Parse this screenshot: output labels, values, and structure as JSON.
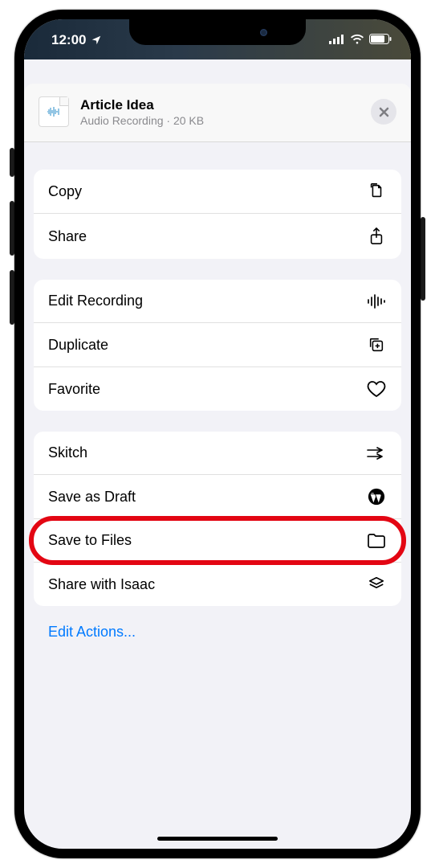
{
  "status": {
    "time": "12:00"
  },
  "header": {
    "title": "Article Idea",
    "subtitle": "Audio Recording · 20 KB"
  },
  "groups": [
    {
      "rows": [
        {
          "label": "Copy",
          "icon": "copy-icon"
        },
        {
          "label": "Share",
          "icon": "share-icon"
        }
      ]
    },
    {
      "rows": [
        {
          "label": "Edit Recording",
          "icon": "waveform-icon"
        },
        {
          "label": "Duplicate",
          "icon": "duplicate-icon"
        },
        {
          "label": "Favorite",
          "icon": "heart-icon"
        }
      ]
    },
    {
      "rows": [
        {
          "label": "Skitch",
          "icon": "arrows-icon"
        },
        {
          "label": "Save as Draft",
          "icon": "wordpress-icon"
        },
        {
          "label": "Save to Files",
          "icon": "folder-icon",
          "highlighted": true
        },
        {
          "label": "Share with Isaac",
          "icon": "stack-icon"
        }
      ]
    }
  ],
  "footer": {
    "edit_actions": "Edit Actions..."
  }
}
